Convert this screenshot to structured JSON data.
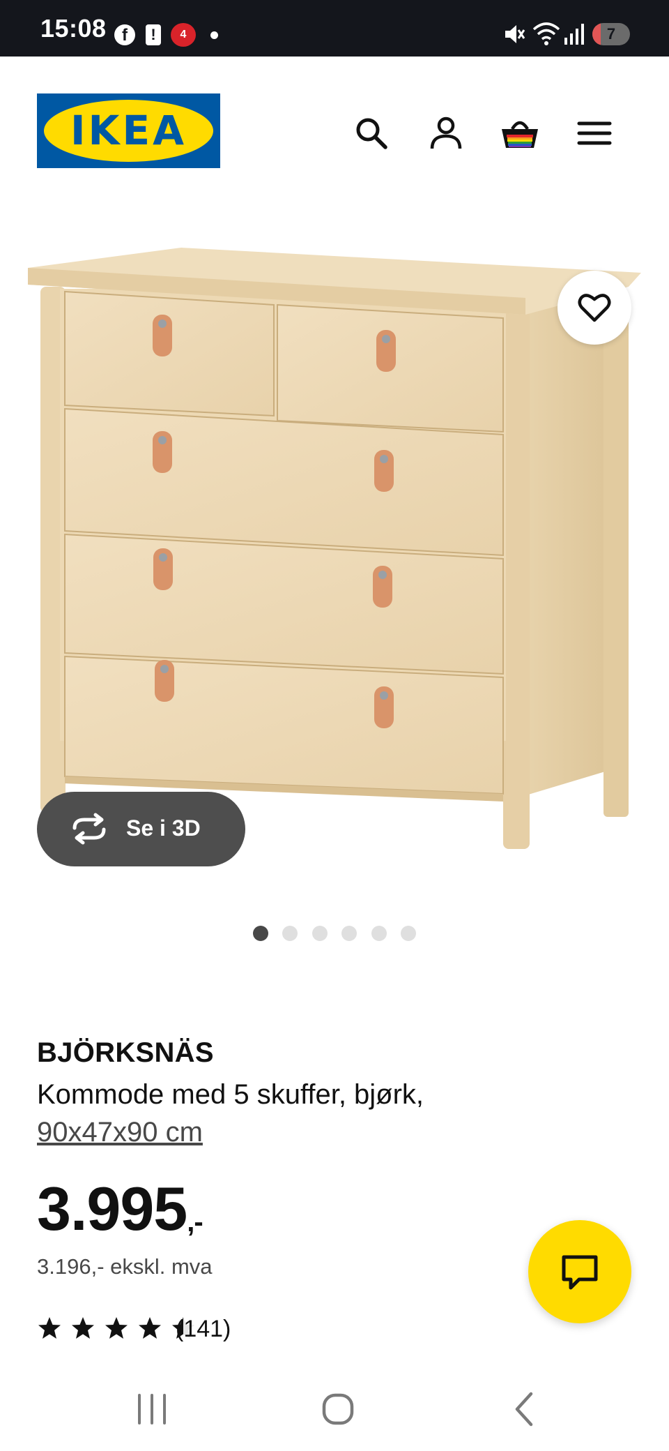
{
  "status_bar": {
    "time": "15:08",
    "notification_badge": "4",
    "battery_level": "7"
  },
  "header": {
    "logo_text": "IKEA",
    "icons": [
      "search-icon",
      "account-icon",
      "basket-icon",
      "menu-icon"
    ]
  },
  "gallery": {
    "view_3d_label": "Se i 3D",
    "slide_count": 6,
    "active_slide": 1
  },
  "product": {
    "name": "BJÖRKSNÄS",
    "description": "Kommode med 5 skuffer, bjørk,",
    "size": "90x47x90 cm",
    "price_main": "3.995",
    "price_suffix": ",-",
    "price_ex_vat": "3.196,- ekskl. mva",
    "rating_value": 4.5,
    "rating_max": 5,
    "rating_count": "(141)"
  },
  "colors": {
    "ikea_blue": "#0058a3",
    "ikea_yellow": "#ffdb00",
    "status_bar_bg": "#14161c"
  }
}
